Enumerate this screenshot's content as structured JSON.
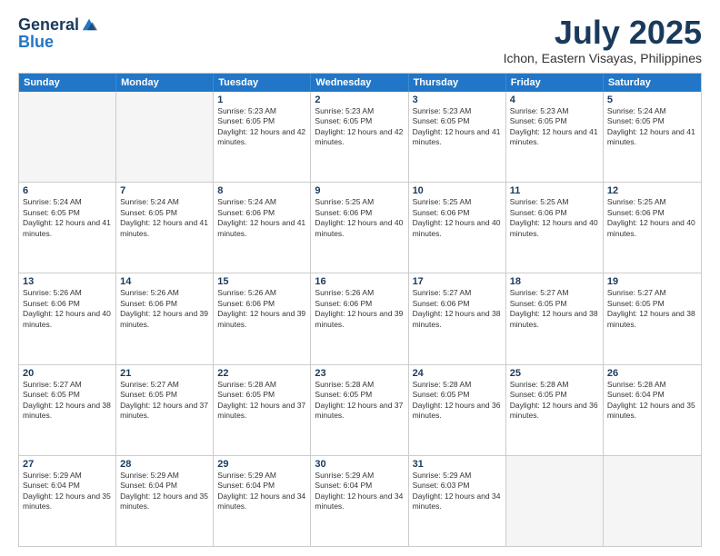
{
  "header": {
    "logo_general": "General",
    "logo_blue": "Blue",
    "month_title": "July 2025",
    "location": "Ichon, Eastern Visayas, Philippines"
  },
  "weekdays": [
    "Sunday",
    "Monday",
    "Tuesday",
    "Wednesday",
    "Thursday",
    "Friday",
    "Saturday"
  ],
  "rows": [
    [
      {
        "day": "",
        "detail": "",
        "empty": true
      },
      {
        "day": "",
        "detail": "",
        "empty": true
      },
      {
        "day": "1",
        "detail": "Sunrise: 5:23 AM\nSunset: 6:05 PM\nDaylight: 12 hours and 42 minutes."
      },
      {
        "day": "2",
        "detail": "Sunrise: 5:23 AM\nSunset: 6:05 PM\nDaylight: 12 hours and 42 minutes."
      },
      {
        "day": "3",
        "detail": "Sunrise: 5:23 AM\nSunset: 6:05 PM\nDaylight: 12 hours and 41 minutes."
      },
      {
        "day": "4",
        "detail": "Sunrise: 5:23 AM\nSunset: 6:05 PM\nDaylight: 12 hours and 41 minutes."
      },
      {
        "day": "5",
        "detail": "Sunrise: 5:24 AM\nSunset: 6:05 PM\nDaylight: 12 hours and 41 minutes."
      }
    ],
    [
      {
        "day": "6",
        "detail": "Sunrise: 5:24 AM\nSunset: 6:05 PM\nDaylight: 12 hours and 41 minutes."
      },
      {
        "day": "7",
        "detail": "Sunrise: 5:24 AM\nSunset: 6:05 PM\nDaylight: 12 hours and 41 minutes."
      },
      {
        "day": "8",
        "detail": "Sunrise: 5:24 AM\nSunset: 6:06 PM\nDaylight: 12 hours and 41 minutes."
      },
      {
        "day": "9",
        "detail": "Sunrise: 5:25 AM\nSunset: 6:06 PM\nDaylight: 12 hours and 40 minutes."
      },
      {
        "day": "10",
        "detail": "Sunrise: 5:25 AM\nSunset: 6:06 PM\nDaylight: 12 hours and 40 minutes."
      },
      {
        "day": "11",
        "detail": "Sunrise: 5:25 AM\nSunset: 6:06 PM\nDaylight: 12 hours and 40 minutes."
      },
      {
        "day": "12",
        "detail": "Sunrise: 5:25 AM\nSunset: 6:06 PM\nDaylight: 12 hours and 40 minutes."
      }
    ],
    [
      {
        "day": "13",
        "detail": "Sunrise: 5:26 AM\nSunset: 6:06 PM\nDaylight: 12 hours and 40 minutes."
      },
      {
        "day": "14",
        "detail": "Sunrise: 5:26 AM\nSunset: 6:06 PM\nDaylight: 12 hours and 39 minutes."
      },
      {
        "day": "15",
        "detail": "Sunrise: 5:26 AM\nSunset: 6:06 PM\nDaylight: 12 hours and 39 minutes."
      },
      {
        "day": "16",
        "detail": "Sunrise: 5:26 AM\nSunset: 6:06 PM\nDaylight: 12 hours and 39 minutes."
      },
      {
        "day": "17",
        "detail": "Sunrise: 5:27 AM\nSunset: 6:06 PM\nDaylight: 12 hours and 38 minutes."
      },
      {
        "day": "18",
        "detail": "Sunrise: 5:27 AM\nSunset: 6:05 PM\nDaylight: 12 hours and 38 minutes."
      },
      {
        "day": "19",
        "detail": "Sunrise: 5:27 AM\nSunset: 6:05 PM\nDaylight: 12 hours and 38 minutes."
      }
    ],
    [
      {
        "day": "20",
        "detail": "Sunrise: 5:27 AM\nSunset: 6:05 PM\nDaylight: 12 hours and 38 minutes."
      },
      {
        "day": "21",
        "detail": "Sunrise: 5:27 AM\nSunset: 6:05 PM\nDaylight: 12 hours and 37 minutes."
      },
      {
        "day": "22",
        "detail": "Sunrise: 5:28 AM\nSunset: 6:05 PM\nDaylight: 12 hours and 37 minutes."
      },
      {
        "day": "23",
        "detail": "Sunrise: 5:28 AM\nSunset: 6:05 PM\nDaylight: 12 hours and 37 minutes."
      },
      {
        "day": "24",
        "detail": "Sunrise: 5:28 AM\nSunset: 6:05 PM\nDaylight: 12 hours and 36 minutes."
      },
      {
        "day": "25",
        "detail": "Sunrise: 5:28 AM\nSunset: 6:05 PM\nDaylight: 12 hours and 36 minutes."
      },
      {
        "day": "26",
        "detail": "Sunrise: 5:28 AM\nSunset: 6:04 PM\nDaylight: 12 hours and 35 minutes."
      }
    ],
    [
      {
        "day": "27",
        "detail": "Sunrise: 5:29 AM\nSunset: 6:04 PM\nDaylight: 12 hours and 35 minutes."
      },
      {
        "day": "28",
        "detail": "Sunrise: 5:29 AM\nSunset: 6:04 PM\nDaylight: 12 hours and 35 minutes."
      },
      {
        "day": "29",
        "detail": "Sunrise: 5:29 AM\nSunset: 6:04 PM\nDaylight: 12 hours and 34 minutes."
      },
      {
        "day": "30",
        "detail": "Sunrise: 5:29 AM\nSunset: 6:04 PM\nDaylight: 12 hours and 34 minutes."
      },
      {
        "day": "31",
        "detail": "Sunrise: 5:29 AM\nSunset: 6:03 PM\nDaylight: 12 hours and 34 minutes."
      },
      {
        "day": "",
        "detail": "",
        "empty": true
      },
      {
        "day": "",
        "detail": "",
        "empty": true
      }
    ]
  ]
}
